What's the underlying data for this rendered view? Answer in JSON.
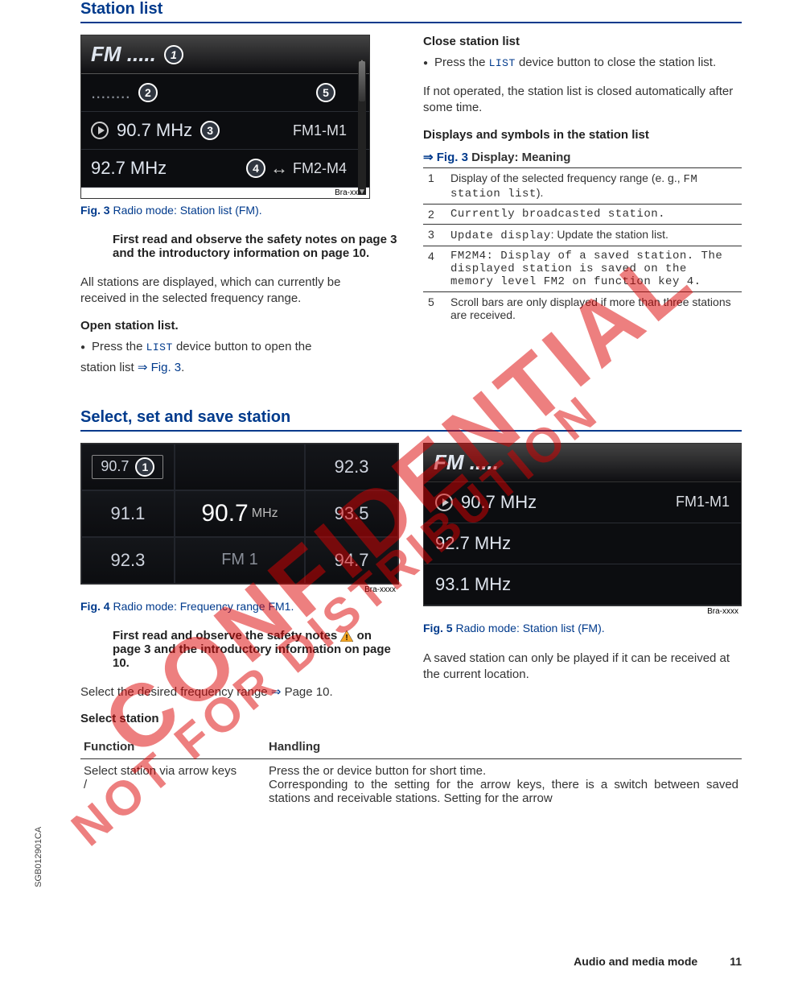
{
  "watermarks": {
    "w1": "CONFIDENTIAL",
    "w2": "NOT FOR DISTRIBUTION"
  },
  "section1": {
    "title": "Station list",
    "fig3": {
      "header": "FM .....",
      "row1_dots": "........",
      "row2_left": "90.7 MHz",
      "row2_right": "FM1-M1",
      "row3_left": "92.7 MHz",
      "row3_right": "FM2-M4",
      "tag": "Bra-xxxx",
      "caption_label": "Fig. 3",
      "caption_text": " Radio mode: Station list (FM)."
    },
    "safety": "First read and observe the safety notes on page 3 and the introductory information on page 10.",
    "p1a": "All stations are displayed, which can currently be ",
    "p1b": "received in the selected frequency range.",
    "open_head": "Open station list.",
    "open_bullet_pre": "Press the ",
    "open_bullet_kw": "LIST",
    "open_bullet_mid": " device button to open the",
    "open_line2_pre": "station list ",
    "open_line2_arrow": "⇒ ",
    "open_line2_ref": "Fig. 3",
    "open_line2_post": ".",
    "close_head": "Close station list",
    "close_bullet_pre": "Press the ",
    "close_bullet_kw": "LIST",
    "close_bullet_post": " device button to close the station list.",
    "close_p2": "If not operated, the station list is closed automatically after some time.",
    "disp_head": "Displays and symbols in the station list",
    "disp_arrow": "⇒ ",
    "disp_ref": "Fig. 3",
    "disp_ref_post": " Display: Meaning",
    "rows": {
      "r1n": "1",
      "r1t_a": "Display of the selected frequency range (e. g., ",
      "r1t_b": "FM station list",
      "r1t_c": ").",
      "r2n": "2",
      "r2t": "Currently broadcasted station.",
      "r3n": "3",
      "r3t_a": "Update display",
      "r3t_b": ": Update the station list.",
      "r4n": "4",
      "r4t": " FM2M4: Display of a saved station. The displayed station is saved on the memory level FM2 on function key 4.",
      "r5n": "5",
      "r5t": "Scroll bars are only displayed if more than three stations are received."
    }
  },
  "section2": {
    "title": "Select, set and save station",
    "fig4": {
      "c00": "90.7",
      "c02": "92.3",
      "c10": "91.1",
      "c11": "90.7",
      "c11_mhz": "MHz",
      "c12": "93.5",
      "c20": "92.3",
      "c21": "FM 1",
      "c22": "94.7",
      "tag": "Bra-xxxx",
      "caption_label": "Fig. 4",
      "caption_text": " Radio mode: Frequency range FM1."
    },
    "fig5": {
      "header": "FM .....",
      "r1_left": "90.7 MHz",
      "r1_right": "FM1-M1",
      "r2": "92.7 MHz",
      "r3": "93.1 MHz",
      "tag": "Bra-xxxx",
      "caption_label": "Fig. 5",
      "caption_text": " Radio mode: Station list (FM)."
    },
    "safety": "First read and observe the safety notes ⚠ on page 3 and the introductory information on page 10.",
    "safety_pre": "First read and observe the safety notes ",
    "safety_post": " on page 3 and the introductory information on page 10.",
    "right_p": "A saved station can only be played if it can be received at the current location.",
    "sel_line_pre": "Select the desired frequency range ",
    "sel_line_arrow": "⇒ ",
    "sel_line_post": "Page 10.",
    "sel_head": "Select station",
    "ftable": {
      "h1": "Function",
      "h2": "Handling",
      "r1c1a": "Select station via arrow keys",
      "r1c1b": "   /",
      "r1c2a": "Press the    or    device button for short time.",
      "r1c2b": "Corresponding to the setting for the arrow keys, there is a switch between saved stations and receivable stations. Setting for the arrow"
    }
  },
  "side_code": "SGB012901CA",
  "footer": {
    "section": "Audio and media mode",
    "page": "11"
  }
}
